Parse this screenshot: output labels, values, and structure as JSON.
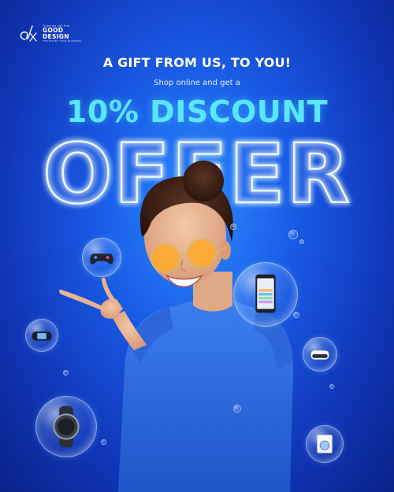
{
  "brand": {
    "monogram": "dx",
    "tagline": "Thing we call first",
    "name_line1": "GOOD",
    "name_line2": "DESIGN",
    "subline": "THE BOOST YOUR BUSINESS"
  },
  "headline": "A GIFT FROM US, TO YOU!",
  "subheadline": "Shop online and get a",
  "discount": "10% DISCOUNT",
  "offer": "OFFER",
  "colors": {
    "background_center": "#2a8cff",
    "background_edge": "#0a2288",
    "discount_text": "#59e6ff",
    "offer_glow": "#cfeeff",
    "tshirt": "#2f6fe0"
  },
  "bubbles": [
    {
      "name": "gamepad",
      "icon": "gamepad-icon"
    },
    {
      "name": "smartphone",
      "icon": "smartphone-icon"
    },
    {
      "name": "handheld-console",
      "icon": "handheld-console-icon"
    },
    {
      "name": "vr-headset",
      "icon": "vr-headset-icon"
    },
    {
      "name": "smartwatch",
      "icon": "smartwatch-icon"
    },
    {
      "name": "washing-machine",
      "icon": "washing-machine-icon"
    }
  ]
}
